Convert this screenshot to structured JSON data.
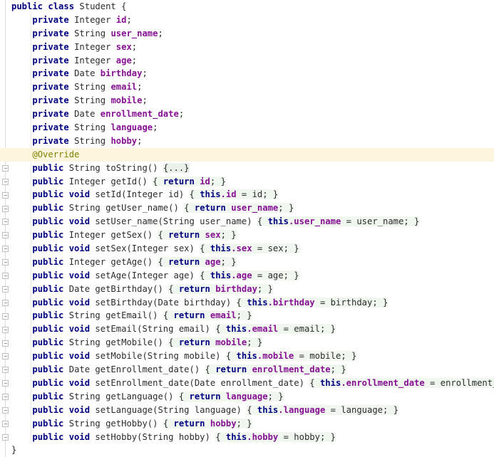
{
  "editor": {
    "language": "Java",
    "class_name": "Student",
    "colors": {
      "background": "#ffffff",
      "foreground": "#2b2b2b",
      "keyword": "#000080",
      "field": "#871094",
      "annotation": "#808000",
      "annotation_line_highlight": "#fdf6dd",
      "method_body_highlight": "#eff7ef",
      "folded_block": "#eaf1ea",
      "gutter_line": "#dcdcdc",
      "indent_guide": "#e8e8e8"
    },
    "gutter": {
      "fold_icon": "fold-collapse-icon",
      "fold_marker_count": 22
    },
    "lines": [
      {
        "indent": 0,
        "fold": false,
        "highlight": false,
        "tokens": [
          {
            "t": "kw",
            "v": "public class "
          },
          {
            "t": "typ",
            "v": "Student {"
          }
        ]
      },
      {
        "indent": 1,
        "fold": false,
        "highlight": false,
        "tokens": [
          {
            "t": "kw",
            "v": "private "
          },
          {
            "t": "typ",
            "v": "Integer "
          },
          {
            "t": "fld",
            "v": "id"
          },
          {
            "t": "pln",
            "v": ";"
          }
        ]
      },
      {
        "indent": 1,
        "fold": false,
        "highlight": false,
        "tokens": [
          {
            "t": "kw",
            "v": "private "
          },
          {
            "t": "typ",
            "v": "String "
          },
          {
            "t": "fld",
            "v": "user_name"
          },
          {
            "t": "pln",
            "v": ";"
          }
        ]
      },
      {
        "indent": 1,
        "fold": false,
        "highlight": false,
        "tokens": [
          {
            "t": "kw",
            "v": "private "
          },
          {
            "t": "typ",
            "v": "Integer "
          },
          {
            "t": "fld",
            "v": "sex"
          },
          {
            "t": "pln",
            "v": ";"
          }
        ]
      },
      {
        "indent": 1,
        "fold": false,
        "highlight": false,
        "tokens": [
          {
            "t": "kw",
            "v": "private "
          },
          {
            "t": "typ",
            "v": "Integer "
          },
          {
            "t": "fld",
            "v": "age"
          },
          {
            "t": "pln",
            "v": ";"
          }
        ]
      },
      {
        "indent": 1,
        "fold": false,
        "highlight": false,
        "tokens": [
          {
            "t": "kw",
            "v": "private "
          },
          {
            "t": "typ",
            "v": "Date "
          },
          {
            "t": "fld",
            "v": "birthday"
          },
          {
            "t": "pln",
            "v": ";"
          }
        ]
      },
      {
        "indent": 1,
        "fold": false,
        "highlight": false,
        "tokens": [
          {
            "t": "kw",
            "v": "private "
          },
          {
            "t": "typ",
            "v": "String "
          },
          {
            "t": "fld",
            "v": "email"
          },
          {
            "t": "pln",
            "v": ";"
          }
        ]
      },
      {
        "indent": 1,
        "fold": false,
        "highlight": false,
        "tokens": [
          {
            "t": "kw",
            "v": "private "
          },
          {
            "t": "typ",
            "v": "String "
          },
          {
            "t": "fld",
            "v": "mobile"
          },
          {
            "t": "pln",
            "v": ";"
          }
        ]
      },
      {
        "indent": 1,
        "fold": false,
        "highlight": false,
        "tokens": [
          {
            "t": "kw",
            "v": "private "
          },
          {
            "t": "typ",
            "v": "Date "
          },
          {
            "t": "fld",
            "v": "enrollment_date"
          },
          {
            "t": "pln",
            "v": ";"
          }
        ]
      },
      {
        "indent": 1,
        "fold": false,
        "highlight": false,
        "tokens": [
          {
            "t": "kw",
            "v": "private "
          },
          {
            "t": "typ",
            "v": "String "
          },
          {
            "t": "fld",
            "v": "language"
          },
          {
            "t": "pln",
            "v": ";"
          }
        ]
      },
      {
        "indent": 1,
        "fold": false,
        "highlight": false,
        "tokens": [
          {
            "t": "kw",
            "v": "private "
          },
          {
            "t": "typ",
            "v": "String "
          },
          {
            "t": "fld",
            "v": "hobby"
          },
          {
            "t": "pln",
            "v": ";"
          }
        ]
      },
      {
        "indent": 1,
        "fold": false,
        "highlight": true,
        "tokens": [
          {
            "t": "ann",
            "v": "@Override"
          }
        ]
      },
      {
        "indent": 1,
        "fold": true,
        "highlight": false,
        "tokens": [
          {
            "t": "kw",
            "v": "public "
          },
          {
            "t": "typ",
            "v": "String toString() "
          },
          {
            "t": "fold",
            "v": "{...}"
          }
        ]
      },
      {
        "indent": 1,
        "fold": true,
        "highlight": false,
        "tokens": [
          {
            "t": "kw",
            "v": "public "
          },
          {
            "t": "typ",
            "v": "Integer getId() "
          },
          {
            "t": "body",
            "v": "{ "
          },
          {
            "t": "kw body",
            "v": "return "
          },
          {
            "t": "fld body",
            "v": "id"
          },
          {
            "t": "body",
            "v": "; }"
          }
        ]
      },
      {
        "indent": 1,
        "fold": true,
        "highlight": false,
        "tokens": [
          {
            "t": "kw",
            "v": "public void "
          },
          {
            "t": "typ",
            "v": "setId(Integer id) "
          },
          {
            "t": "body",
            "v": "{ "
          },
          {
            "t": "kw body",
            "v": "this"
          },
          {
            "t": "fld body",
            "v": ".id"
          },
          {
            "t": "body",
            "v": " = id; }"
          }
        ]
      },
      {
        "indent": 1,
        "fold": true,
        "highlight": false,
        "tokens": [
          {
            "t": "kw",
            "v": "public "
          },
          {
            "t": "typ",
            "v": "String getUser_name() "
          },
          {
            "t": "body",
            "v": "{ "
          },
          {
            "t": "kw body",
            "v": "return "
          },
          {
            "t": "fld body",
            "v": "user_name"
          },
          {
            "t": "body",
            "v": "; }"
          }
        ]
      },
      {
        "indent": 1,
        "fold": true,
        "highlight": false,
        "tokens": [
          {
            "t": "kw",
            "v": "public void "
          },
          {
            "t": "typ",
            "v": "setUser_name(String user_name) "
          },
          {
            "t": "body",
            "v": "{ "
          },
          {
            "t": "kw body",
            "v": "this"
          },
          {
            "t": "fld body",
            "v": ".user_name"
          },
          {
            "t": "body",
            "v": " = user_name; }"
          }
        ]
      },
      {
        "indent": 1,
        "fold": true,
        "highlight": false,
        "tokens": [
          {
            "t": "kw",
            "v": "public "
          },
          {
            "t": "typ",
            "v": "Integer getSex() "
          },
          {
            "t": "body",
            "v": "{ "
          },
          {
            "t": "kw body",
            "v": "return "
          },
          {
            "t": "fld body",
            "v": "sex"
          },
          {
            "t": "body",
            "v": "; }"
          }
        ]
      },
      {
        "indent": 1,
        "fold": true,
        "highlight": false,
        "tokens": [
          {
            "t": "kw",
            "v": "public void "
          },
          {
            "t": "typ",
            "v": "setSex(Integer sex) "
          },
          {
            "t": "body",
            "v": "{ "
          },
          {
            "t": "kw body",
            "v": "this"
          },
          {
            "t": "fld body",
            "v": ".sex"
          },
          {
            "t": "body",
            "v": " = sex; }"
          }
        ]
      },
      {
        "indent": 1,
        "fold": true,
        "highlight": false,
        "tokens": [
          {
            "t": "kw",
            "v": "public "
          },
          {
            "t": "typ",
            "v": "Integer getAge() "
          },
          {
            "t": "body",
            "v": "{ "
          },
          {
            "t": "kw body",
            "v": "return "
          },
          {
            "t": "fld body",
            "v": "age"
          },
          {
            "t": "body",
            "v": "; }"
          }
        ]
      },
      {
        "indent": 1,
        "fold": true,
        "highlight": false,
        "tokens": [
          {
            "t": "kw",
            "v": "public void "
          },
          {
            "t": "typ",
            "v": "setAge(Integer age) "
          },
          {
            "t": "body",
            "v": "{ "
          },
          {
            "t": "kw body",
            "v": "this"
          },
          {
            "t": "fld body",
            "v": ".age"
          },
          {
            "t": "body",
            "v": " = age; }"
          }
        ]
      },
      {
        "indent": 1,
        "fold": true,
        "highlight": false,
        "tokens": [
          {
            "t": "kw",
            "v": "public "
          },
          {
            "t": "typ",
            "v": "Date getBirthday() "
          },
          {
            "t": "body",
            "v": "{ "
          },
          {
            "t": "kw body",
            "v": "return "
          },
          {
            "t": "fld body",
            "v": "birthday"
          },
          {
            "t": "body",
            "v": "; }"
          }
        ]
      },
      {
        "indent": 1,
        "fold": true,
        "highlight": false,
        "tokens": [
          {
            "t": "kw",
            "v": "public void "
          },
          {
            "t": "typ",
            "v": "setBirthday(Date birthday) "
          },
          {
            "t": "body",
            "v": "{ "
          },
          {
            "t": "kw body",
            "v": "this"
          },
          {
            "t": "fld body",
            "v": ".birthday"
          },
          {
            "t": "body",
            "v": " = birthday; }"
          }
        ]
      },
      {
        "indent": 1,
        "fold": true,
        "highlight": false,
        "tokens": [
          {
            "t": "kw",
            "v": "public "
          },
          {
            "t": "typ",
            "v": "String getEmail() "
          },
          {
            "t": "body",
            "v": "{ "
          },
          {
            "t": "kw body",
            "v": "return "
          },
          {
            "t": "fld body",
            "v": "email"
          },
          {
            "t": "body",
            "v": "; }"
          }
        ]
      },
      {
        "indent": 1,
        "fold": true,
        "highlight": false,
        "tokens": [
          {
            "t": "kw",
            "v": "public void "
          },
          {
            "t": "typ",
            "v": "setEmail(String email) "
          },
          {
            "t": "body",
            "v": "{ "
          },
          {
            "t": "kw body",
            "v": "this"
          },
          {
            "t": "fld body",
            "v": ".email"
          },
          {
            "t": "body",
            "v": " = email; }"
          }
        ]
      },
      {
        "indent": 1,
        "fold": true,
        "highlight": false,
        "tokens": [
          {
            "t": "kw",
            "v": "public "
          },
          {
            "t": "typ",
            "v": "String getMobile() "
          },
          {
            "t": "body",
            "v": "{ "
          },
          {
            "t": "kw body",
            "v": "return "
          },
          {
            "t": "fld body",
            "v": "mobile"
          },
          {
            "t": "body",
            "v": "; }"
          }
        ]
      },
      {
        "indent": 1,
        "fold": true,
        "highlight": false,
        "tokens": [
          {
            "t": "kw",
            "v": "public void "
          },
          {
            "t": "typ",
            "v": "setMobile(String mobile) "
          },
          {
            "t": "body",
            "v": "{ "
          },
          {
            "t": "kw body",
            "v": "this"
          },
          {
            "t": "fld body",
            "v": ".mobile"
          },
          {
            "t": "body",
            "v": " = mobile; }"
          }
        ]
      },
      {
        "indent": 1,
        "fold": true,
        "highlight": false,
        "tokens": [
          {
            "t": "kw",
            "v": "public "
          },
          {
            "t": "typ",
            "v": "Date getEnrollment_date() "
          },
          {
            "t": "body",
            "v": "{ "
          },
          {
            "t": "kw body",
            "v": "return "
          },
          {
            "t": "fld body",
            "v": "enrollment_date"
          },
          {
            "t": "body",
            "v": "; }"
          }
        ]
      },
      {
        "indent": 1,
        "fold": true,
        "highlight": false,
        "tokens": [
          {
            "t": "kw",
            "v": "public void "
          },
          {
            "t": "typ",
            "v": "setEnrollment_date(Date enrollment_date) "
          },
          {
            "t": "body",
            "v": "{ "
          },
          {
            "t": "kw body",
            "v": "this"
          },
          {
            "t": "fld body",
            "v": ".enrollment_date"
          },
          {
            "t": "body",
            "v": " = enrollment_date; }"
          }
        ]
      },
      {
        "indent": 1,
        "fold": true,
        "highlight": false,
        "tokens": [
          {
            "t": "kw",
            "v": "public "
          },
          {
            "t": "typ",
            "v": "String getLanguage() "
          },
          {
            "t": "body",
            "v": "{ "
          },
          {
            "t": "kw body",
            "v": "return "
          },
          {
            "t": "fld body",
            "v": "language"
          },
          {
            "t": "body",
            "v": "; }"
          }
        ]
      },
      {
        "indent": 1,
        "fold": true,
        "highlight": false,
        "tokens": [
          {
            "t": "kw",
            "v": "public void "
          },
          {
            "t": "typ",
            "v": "setLanguage(String language) "
          },
          {
            "t": "body",
            "v": "{ "
          },
          {
            "t": "kw body",
            "v": "this"
          },
          {
            "t": "fld body",
            "v": ".language"
          },
          {
            "t": "body",
            "v": " = language; }"
          }
        ]
      },
      {
        "indent": 1,
        "fold": true,
        "highlight": false,
        "tokens": [
          {
            "t": "kw",
            "v": "public "
          },
          {
            "t": "typ",
            "v": "String getHobby() "
          },
          {
            "t": "body",
            "v": "{ "
          },
          {
            "t": "kw body",
            "v": "return "
          },
          {
            "t": "fld body",
            "v": "hobby"
          },
          {
            "t": "body",
            "v": "; }"
          }
        ]
      },
      {
        "indent": 1,
        "fold": true,
        "highlight": false,
        "tokens": [
          {
            "t": "kw",
            "v": "public void "
          },
          {
            "t": "typ",
            "v": "setHobby(String hobby) "
          },
          {
            "t": "body",
            "v": "{ "
          },
          {
            "t": "kw body",
            "v": "this"
          },
          {
            "t": "fld body",
            "v": ".hobby"
          },
          {
            "t": "body",
            "v": " = hobby; }"
          }
        ]
      },
      {
        "indent": 0,
        "fold": false,
        "highlight": false,
        "tokens": [
          {
            "t": "typ",
            "v": "}"
          }
        ]
      }
    ]
  }
}
